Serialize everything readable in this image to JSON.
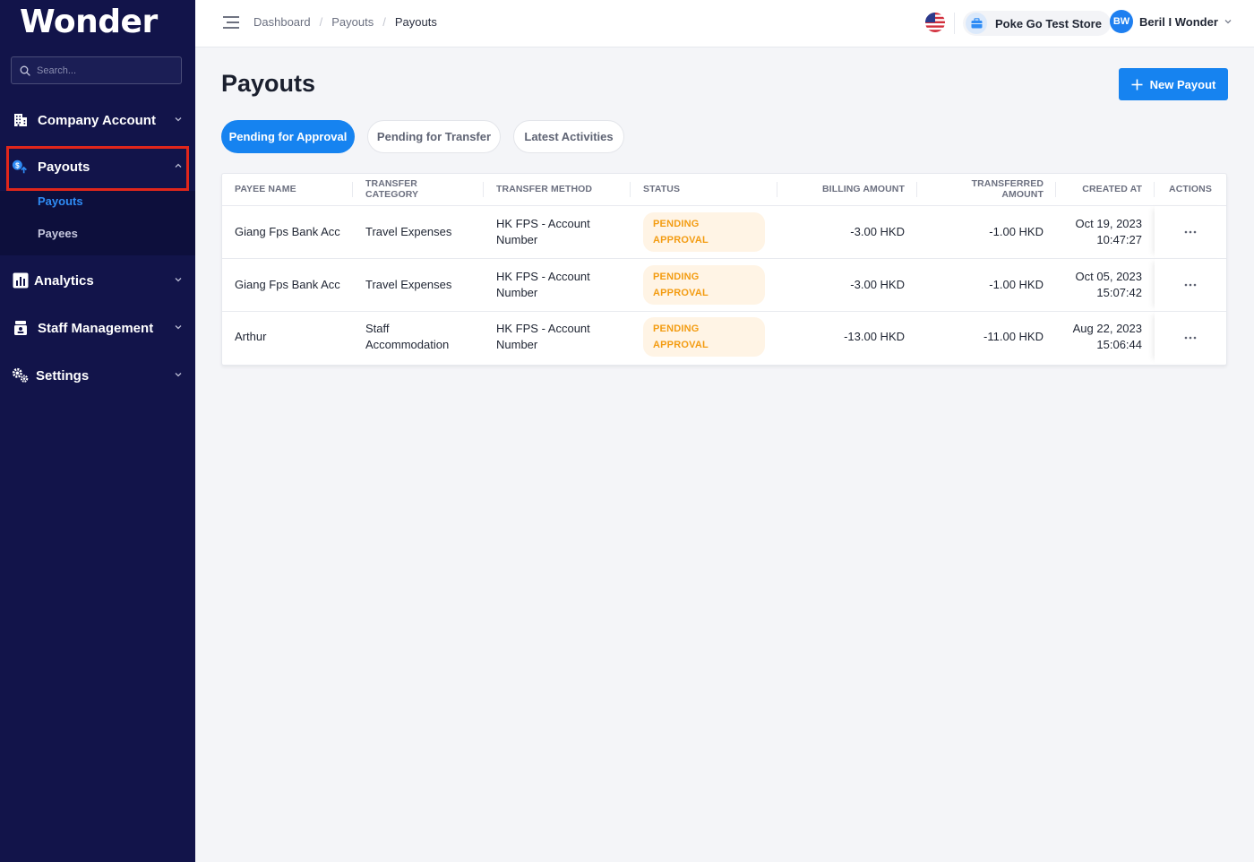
{
  "app": {
    "logo": "Wonder"
  },
  "search": {
    "placeholder": "Search..."
  },
  "sidebar": {
    "company_account": "Company Account",
    "payouts": "Payouts",
    "payouts_sub": [
      "Payouts",
      "Payees"
    ],
    "analytics": "Analytics",
    "staff_management": "Staff Management",
    "settings": "Settings"
  },
  "breadcrumb": [
    "Dashboard",
    "Payouts",
    "Payouts"
  ],
  "header": {
    "store_name": "Poke Go Test Store",
    "user_initials": "BW",
    "user_name": "Beril I Wonder"
  },
  "page": {
    "title": "Payouts",
    "new_button": "New Payout",
    "tabs": [
      "Pending for Approval",
      "Pending for Transfer",
      "Latest Activities"
    ]
  },
  "table": {
    "columns": [
      "PAYEE NAME",
      "TRANSFER CATEGORY",
      "TRANSFER METHOD",
      "STATUS",
      "BILLING AMOUNT",
      "TRANSFERRED AMOUNT",
      "CREATED AT",
      "ACTIONS"
    ],
    "rows": [
      {
        "payee": "Giang Fps Bank Acc",
        "category": "Travel Expenses",
        "method": "HK FPS - Account Number",
        "status": "PENDING APPROVAL",
        "billing": "-3.00 HKD",
        "transferred": "-1.00 HKD",
        "date": "Oct 19, 2023",
        "time": "10:47:27"
      },
      {
        "payee": "Giang Fps Bank Acc",
        "category": "Travel Expenses",
        "method": "HK FPS - Account Number",
        "status": "PENDING APPROVAL",
        "billing": "-3.00 HKD",
        "transferred": "-1.00 HKD",
        "date": "Oct 05, 2023",
        "time": "15:07:42"
      },
      {
        "payee": "Arthur",
        "category": "Staff Accommodation",
        "method": "HK FPS - Account Number",
        "status": "PENDING APPROVAL",
        "billing": "-13.00 HKD",
        "transferred": "-11.00 HKD",
        "date": "Aug 22, 2023",
        "time": "15:06:44"
      }
    ]
  },
  "colors": {
    "sidebar_bg": "#12144a",
    "accent": "#1683f0",
    "highlight_border": "#e0261b",
    "status_pending": "#f39c12"
  },
  "icons": {
    "menu": "menu-toggle-icon",
    "company": "building-icon",
    "payouts": "payout-icon",
    "analytics": "bar-chart-icon",
    "staff": "staff-icon",
    "settings": "gears-icon",
    "store": "store-icon",
    "flag": "us-flag-icon",
    "actions": "more-horizontal-icon"
  }
}
